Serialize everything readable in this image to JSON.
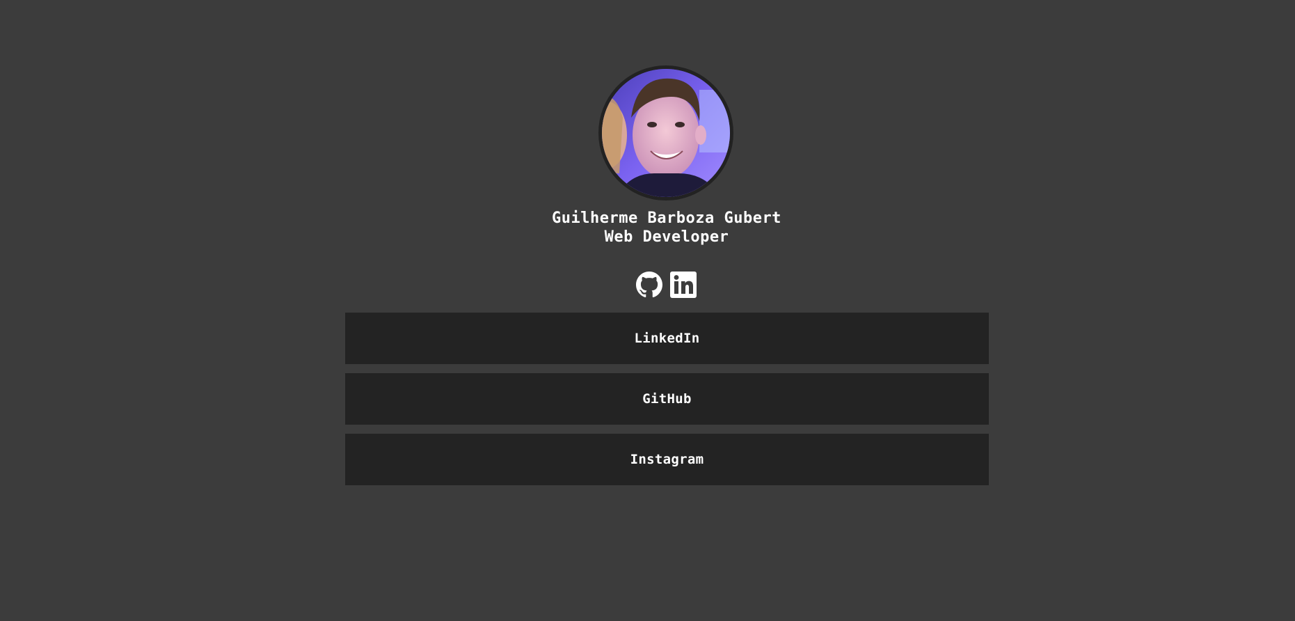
{
  "profile": {
    "name": "Guilherme Barboza Gubert",
    "role": "Web Developer",
    "avatar_icon": "profile-photo"
  },
  "social": {
    "github_icon": "github-icon",
    "linkedin_icon": "linkedin-icon"
  },
  "links": [
    {
      "label": "LinkedIn"
    },
    {
      "label": "GitHub"
    },
    {
      "label": "Instagram"
    }
  ],
  "colors": {
    "background": "#3c3c3c",
    "button_background": "#232323",
    "text": "#ffffff",
    "avatar_border": "#222222"
  }
}
